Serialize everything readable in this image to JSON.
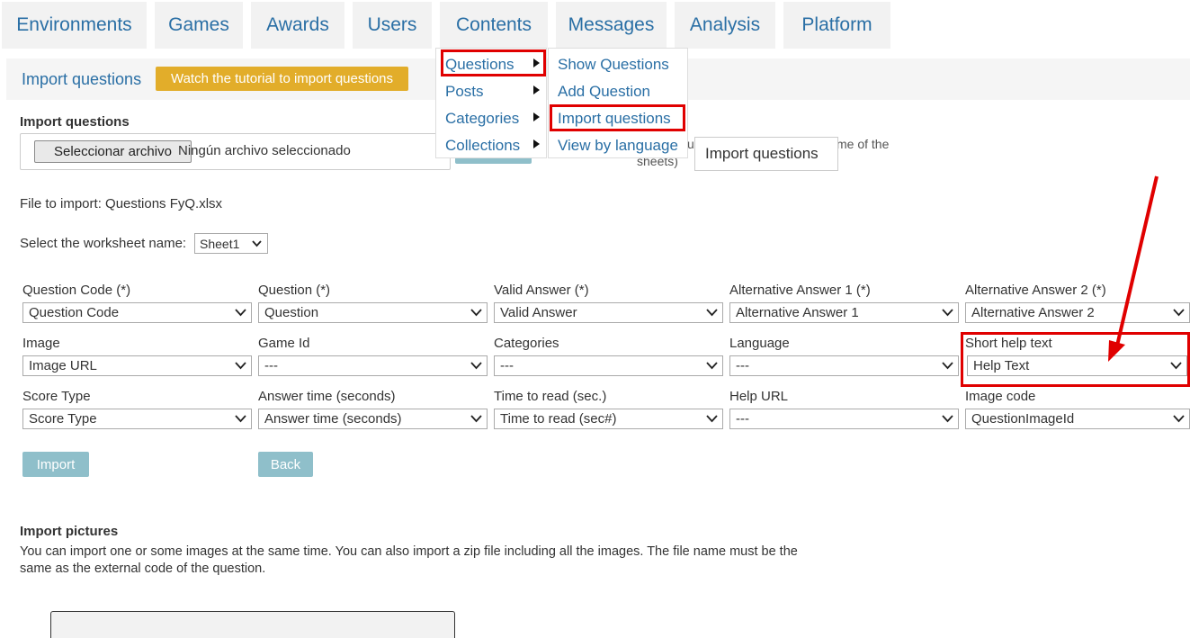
{
  "nav": {
    "items": [
      "Environments",
      "Games",
      "Awards",
      "Users",
      "Contents",
      "Messages",
      "Analysis",
      "Platform"
    ]
  },
  "subheader": {
    "title": "Import questions",
    "tutorial_label": "Watch the tutorial to import questions"
  },
  "import_section": {
    "label": "Import questions",
    "file_button": "Seleccionar archivo",
    "file_none": "Ningún archivo seleccionado",
    "behind_text_1": "me of the",
    "behind_text_2": "sheets)",
    "behind_text_3": "us",
    "tooltip": "Import questions",
    "file_to_import": "File to import: Questions FyQ.xlsx",
    "worksheet_label": "Select the worksheet name:",
    "worksheet_value": "Sheet1"
  },
  "menus": {
    "contents": [
      "Questions",
      "Posts",
      "Categories",
      "Collections"
    ],
    "questions": [
      "Show Questions",
      "Add Question",
      "Import questions",
      "View by language"
    ]
  },
  "mapping": {
    "row1": [
      {
        "label": "Question Code (*)",
        "value": "Question Code"
      },
      {
        "label": "Question (*)",
        "value": "Question"
      },
      {
        "label": "Valid Answer (*)",
        "value": "Valid Answer"
      },
      {
        "label": "Alternative Answer 1 (*)",
        "value": "Alternative Answer 1"
      },
      {
        "label": "Alternative Answer 2 (*)",
        "value": "Alternative Answer 2"
      }
    ],
    "row2": [
      {
        "label": "Image",
        "value": "Image URL"
      },
      {
        "label": "Game Id",
        "value": "---"
      },
      {
        "label": "Categories",
        "value": "---"
      },
      {
        "label": "Language",
        "value": "---"
      },
      {
        "label": "Short help text",
        "value": "Help Text"
      }
    ],
    "row3": [
      {
        "label": "Score Type",
        "value": "Score Type"
      },
      {
        "label": "Answer time (seconds)",
        "value": "Answer time (seconds)"
      },
      {
        "label": "Time to read (sec.)",
        "value": "Time to read (sec#)"
      },
      {
        "label": "Help URL",
        "value": "---"
      },
      {
        "label": "Image code",
        "value": "QuestionImageId"
      }
    ]
  },
  "actions": {
    "import_label": "Import",
    "back_label": "Back"
  },
  "pictures": {
    "title": "Import pictures",
    "desc_line1": "You can import one or some images at the same time. You can also import a zip file including all the images. The file name must be the",
    "desc_line2": "same as the external code of the question."
  },
  "colors": {
    "nav_text": "#2a6fa5",
    "tutorial_bg": "#e2ad2a",
    "button_bg": "#8fbfca",
    "highlight": "#e00000"
  }
}
